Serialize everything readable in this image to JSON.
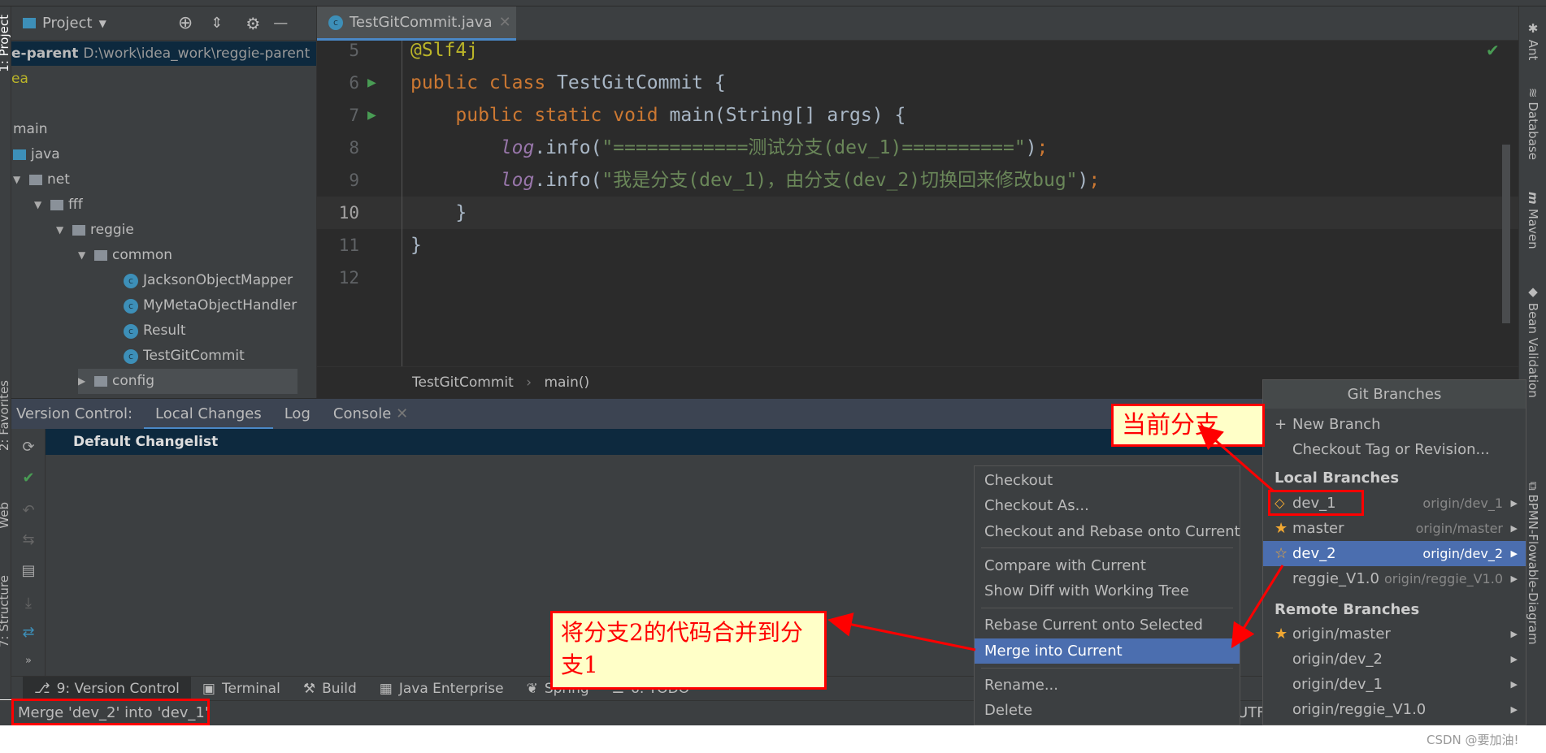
{
  "project_panel": {
    "title": "Project",
    "root_name": "e-parent",
    "root_path": "D:\\work\\idea_work\\reggie-parent",
    "items": [
      {
        "label": "ea"
      },
      {
        "label": "main"
      },
      {
        "label": "java"
      },
      {
        "label": "net"
      },
      {
        "label": "fff"
      },
      {
        "label": "reggie"
      },
      {
        "label": "common"
      },
      {
        "label": "JacksonObjectMapper"
      },
      {
        "label": "MyMetaObjectHandler"
      },
      {
        "label": "Result"
      },
      {
        "label": "TestGitCommit"
      },
      {
        "label": "config"
      }
    ]
  },
  "editor": {
    "tab": "TestGitCommit.java",
    "lines": [
      {
        "n": "5",
        "parts": [
          [
            "ann",
            "@Slf4j"
          ]
        ]
      },
      {
        "n": "6",
        "parts": [
          [
            "kw",
            "public class "
          ],
          [
            "plain",
            "TestGitCommit {"
          ]
        ]
      },
      {
        "n": "7",
        "parts": [
          [
            "kw",
            "    public static void "
          ],
          [
            "plain",
            "main(String[] args) {"
          ]
        ]
      },
      {
        "n": "8",
        "parts": [
          [
            "log",
            "        log"
          ],
          [
            "plain",
            ".info("
          ],
          [
            "str",
            "\"============测试分支(dev_1)==========\""
          ],
          [
            "plain",
            ")"
          ],
          [
            "kw",
            ";"
          ]
        ]
      },
      {
        "n": "9",
        "parts": [
          [
            "log",
            "        log"
          ],
          [
            "plain",
            ".info("
          ],
          [
            "str",
            "\"我是分支(dev_1)，由分支(dev_2)切换回来修改bug\""
          ],
          [
            "plain",
            ")"
          ],
          [
            "kw",
            ";"
          ]
        ]
      },
      {
        "n": "10",
        "parts": [
          [
            "plain",
            "    }"
          ]
        ]
      },
      {
        "n": "11",
        "parts": [
          [
            "plain",
            "}"
          ]
        ]
      },
      {
        "n": "12",
        "parts": []
      }
    ],
    "breadcrumb": [
      "TestGitCommit",
      "main()"
    ]
  },
  "version_control": {
    "label": "Version Control:",
    "tabs": [
      "Local Changes",
      "Log",
      "Console"
    ],
    "changelist": "Default Changelist"
  },
  "tool_windows": [
    "9: Version Control",
    "Terminal",
    "Build",
    "Java Enterprise",
    "Spring",
    "6: TODO"
  ],
  "status": {
    "message": "Merge 'dev_2' into 'dev_1'",
    "encoding": "UTF"
  },
  "right_tools": [
    "Ant",
    "Database",
    "Maven",
    "Bean Validation",
    "BPMN-Flowable-Diagram"
  ],
  "left_tools": [
    "1: Project",
    "2: Favorites",
    "Web",
    "7: Structure"
  ],
  "context_menu": [
    "Checkout",
    "Checkout As...",
    "Checkout and Rebase onto Current",
    "Compare with Current",
    "Show Diff with Working Tree",
    "Rebase Current onto Selected",
    "Merge into Current",
    "Rename...",
    "Delete"
  ],
  "git_branches": {
    "title": "Git Branches",
    "actions": [
      "New Branch",
      "Checkout Tag or Revision..."
    ],
    "local_header": "Local Branches",
    "local": [
      {
        "name": "dev_1",
        "remote": "origin/dev_1",
        "icon": "tag-icon"
      },
      {
        "name": "master",
        "remote": "origin/master",
        "icon": "star-icon"
      },
      {
        "name": "dev_2",
        "remote": "origin/dev_2",
        "icon": "star-outline-icon",
        "selected": true
      },
      {
        "name": "reggie_V1.0",
        "remote": "origin/reggie_V1.0"
      }
    ],
    "remote_header": "Remote Branches",
    "remote": [
      {
        "name": "origin/master",
        "icon": "star-icon"
      },
      {
        "name": "origin/dev_2"
      },
      {
        "name": "origin/dev_1"
      },
      {
        "name": "origin/reggie_V1.0"
      }
    ]
  },
  "annotations": {
    "current_branch": "当前分支",
    "merge_note": "将分支2的代码合并到分支1"
  },
  "watermark": "CSDN @要加油!",
  "colors": {
    "highlight": "#4b6eaf",
    "keyword": "#cc7832",
    "string": "#6a8759",
    "annotation_red": "#ff0000"
  }
}
